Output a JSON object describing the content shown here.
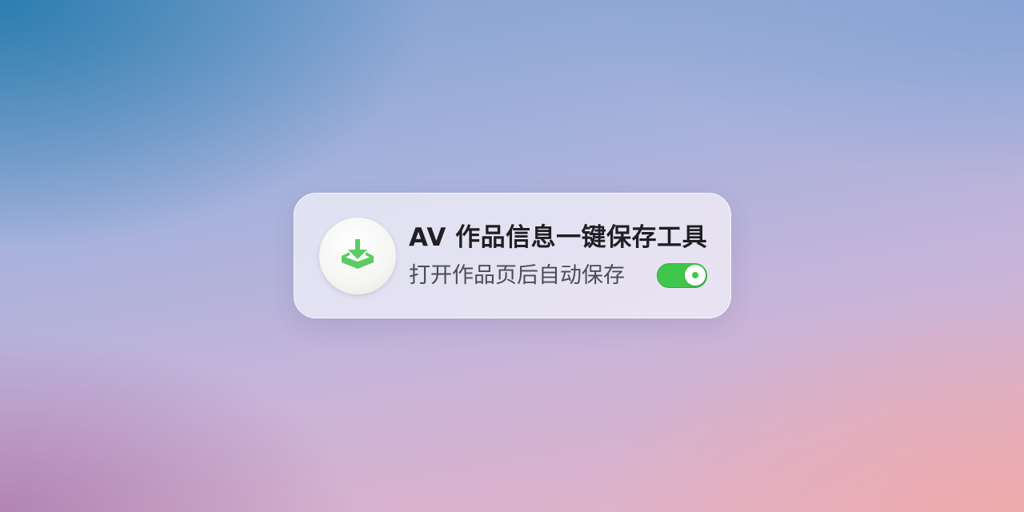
{
  "card": {
    "icon": "download-tray-icon",
    "title": "AV 作品信息一键保存工具",
    "subtitle": "打开作品页后自动保存",
    "toggle": {
      "state": "on",
      "accent_color": "#3fc74c"
    }
  }
}
